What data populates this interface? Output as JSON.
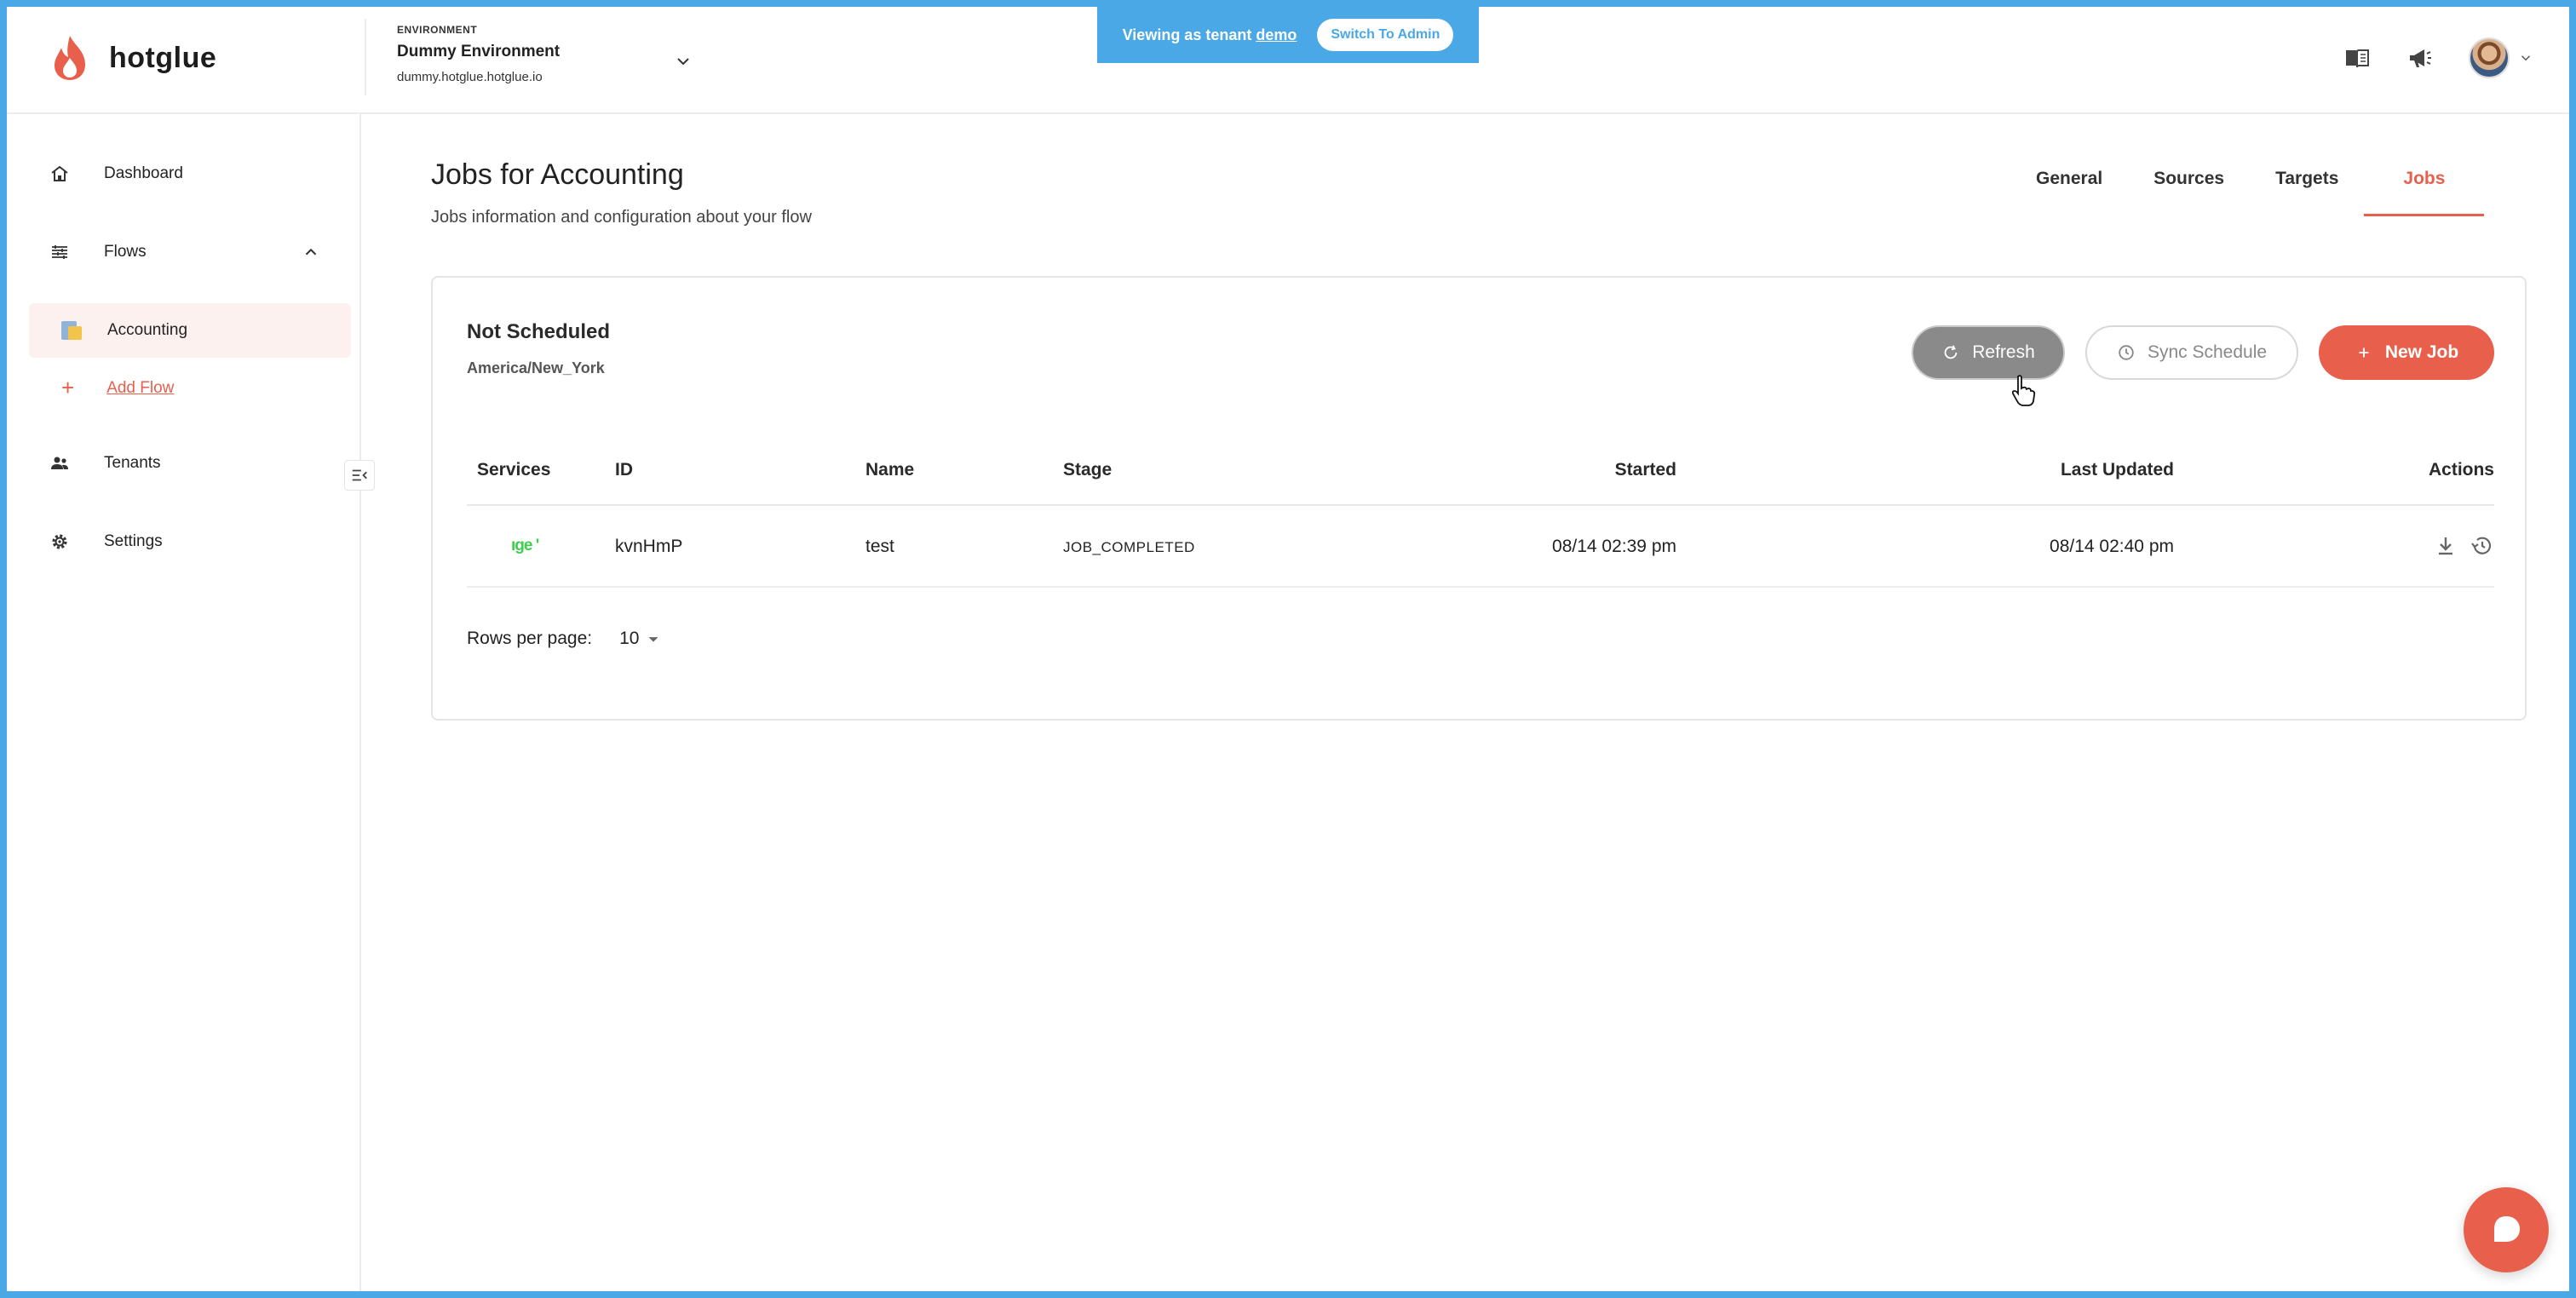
{
  "brand": {
    "name": "hotglue",
    "accent": "#e8604c",
    "banner": "#4aa8e6"
  },
  "environment": {
    "label": "ENVIRONMENT",
    "name": "Dummy Environment",
    "url": "dummy.hotglue.hotglue.io"
  },
  "tenant_banner": {
    "prefix": "Viewing as tenant",
    "tenant": "demo",
    "switch_label": "Switch To Admin"
  },
  "header_icons": [
    "docs-book-icon",
    "announcement-megaphone-icon",
    "user-avatar"
  ],
  "sidebar": {
    "items": [
      {
        "label": "Dashboard",
        "icon": "home-icon"
      },
      {
        "label": "Flows",
        "icon": "flows-icon"
      },
      {
        "label": "Tenants",
        "icon": "users-icon"
      },
      {
        "label": "Settings",
        "icon": "gear-icon"
      }
    ],
    "flows_children": [
      {
        "label": "Accounting"
      }
    ],
    "add_flow_label": "Add Flow"
  },
  "page": {
    "title": "Jobs for Accounting",
    "subtitle": "Jobs information and configuration about your flow",
    "tabs": [
      {
        "label": "General",
        "active": false
      },
      {
        "label": "Sources",
        "active": false
      },
      {
        "label": "Targets",
        "active": false
      },
      {
        "label": "Jobs",
        "active": true
      }
    ]
  },
  "schedule": {
    "status": "Not Scheduled",
    "timezone": "America/New_York"
  },
  "buttons": {
    "refresh": "Refresh",
    "sync_schedule": "Sync Schedule",
    "new_job": "New Job"
  },
  "table": {
    "columns": [
      "Services",
      "ID",
      "Name",
      "Stage",
      "Started",
      "Last Updated",
      "Actions"
    ],
    "rows": [
      {
        "service": "ıge '",
        "id": "kvnHmP",
        "name": "test",
        "stage": "JOB_COMPLETED",
        "started": "08/14 02:39 pm",
        "last_updated": "08/14 02:40 pm"
      }
    ]
  },
  "pagination": {
    "rows_per_page_label": "Rows per page:",
    "rows_per_page_value": "10"
  }
}
